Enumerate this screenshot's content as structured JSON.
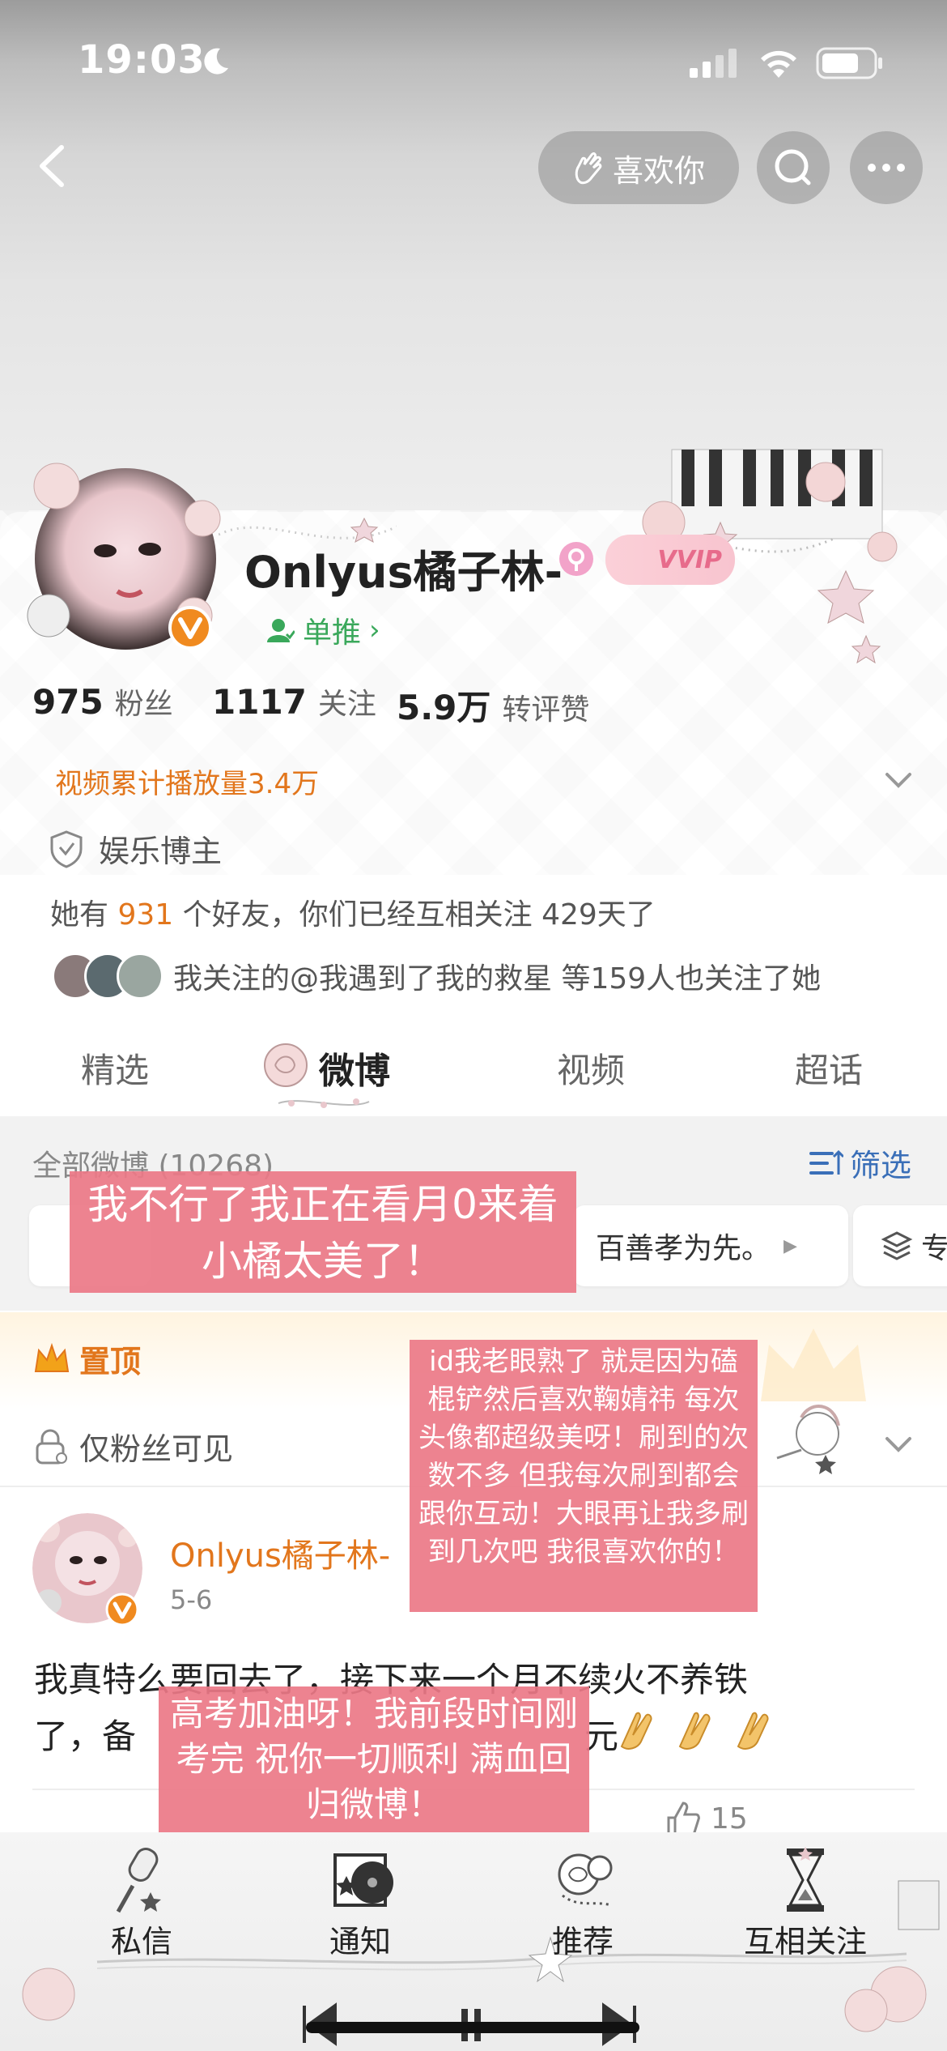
{
  "status": {
    "time": "19:03"
  },
  "nav": {
    "like_label": "喜欢你"
  },
  "profile": {
    "name": "Onlyus橘子林-",
    "vip_badge": "VVIP",
    "group_label": "单推",
    "stats": [
      {
        "num": "975",
        "label": "粉丝"
      },
      {
        "num": "1117",
        "label": "关注"
      },
      {
        "num": "5.9万",
        "label": "转评赞"
      }
    ],
    "video_plays": "视频累计播放量3.4万",
    "category": "娱乐博主",
    "friends_prefix": "她有",
    "friends_count": "931",
    "friends_suffix": "个好友，你们已经互相关注 429天了",
    "mutual_follow": "我关注的@我遇到了我的救星 等159人也关注了她"
  },
  "tabs": [
    "精选",
    "微博",
    "视频",
    "超话"
  ],
  "feed": {
    "all_posts": "全部微博 (10268)",
    "filter_label": "筛选",
    "chip_middle": "百善孝为先。",
    "chip_right": "专"
  },
  "pinned": {
    "label": "置顶",
    "visibility": "仅粉丝可见"
  },
  "post": {
    "author": "Onlyus橘子林-",
    "date": "5-6",
    "text_line1": "我真特么要回去了，接下来一个月不续火不养铁",
    "text_line2_start": "了，备",
    "text_line2_end": "元",
    "like_count": "15"
  },
  "notes": {
    "note1": "我不行了我正在看月0来着 小橘太美了！",
    "note2": "id我老眼熟了 就是因为磕棍铲然后喜欢鞠婧祎 每次头像都超级美呀！刷到的次数不多 但我每次刷到都会跟你互动！大眼再让我多刷到几次吧 我很喜欢你的！",
    "note3": "高考加油呀！我前段时间刚考完 祝你一切顺利 满血回归微博！"
  },
  "bottom_nav": [
    "私信",
    "通知",
    "推荐",
    "互相关注"
  ],
  "colors": {
    "orange": "#e2761c",
    "green": "#3aa85b",
    "blue": "#3a6fb8",
    "pink_note": "#ec7887"
  }
}
